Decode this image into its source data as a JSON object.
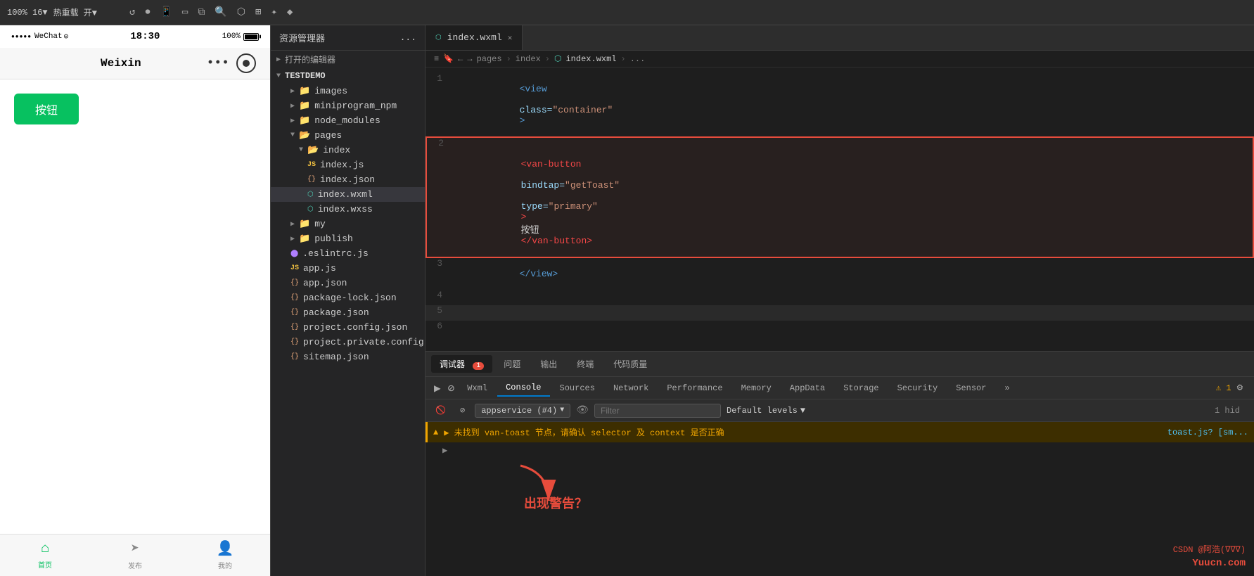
{
  "toolbar": {
    "zoom_label": "100% 16▼",
    "hot_reload_label": "热重载 开▼",
    "icons": [
      "↺",
      "⏺",
      "📱",
      "⬜",
      "📋",
      "🔍",
      "⬡",
      "⬢",
      "✦",
      "♦"
    ]
  },
  "explorer": {
    "title": "资源管理器",
    "more": "...",
    "open_editors_label": "打开的编辑器",
    "project_name": "TESTDEMO",
    "folders": [
      {
        "name": "images",
        "indent": 2,
        "type": "folder"
      },
      {
        "name": "miniprogram_npm",
        "indent": 2,
        "type": "folder"
      },
      {
        "name": "node_modules",
        "indent": 2,
        "type": "folder"
      },
      {
        "name": "pages",
        "indent": 2,
        "type": "folder"
      },
      {
        "name": "index",
        "indent": 3,
        "type": "folder"
      },
      {
        "name": "index.js",
        "indent": 4,
        "type": "js"
      },
      {
        "name": "index.json",
        "indent": 4,
        "type": "json"
      },
      {
        "name": "index.wxml",
        "indent": 4,
        "type": "wxml",
        "active": true
      },
      {
        "name": "index.wxss",
        "indent": 4,
        "type": "wxss"
      },
      {
        "name": "my",
        "indent": 2,
        "type": "folder"
      },
      {
        "name": "publish",
        "indent": 2,
        "type": "folder"
      },
      {
        "name": ".eslintrc.js",
        "indent": 2,
        "type": "eslint"
      },
      {
        "name": "app.js",
        "indent": 2,
        "type": "js"
      },
      {
        "name": "app.json",
        "indent": 2,
        "type": "json"
      },
      {
        "name": "package-lock.json",
        "indent": 2,
        "type": "json"
      },
      {
        "name": "package.json",
        "indent": 2,
        "type": "json"
      },
      {
        "name": "project.config.json",
        "indent": 2,
        "type": "json"
      },
      {
        "name": "project.private.config.js...",
        "indent": 2,
        "type": "json"
      },
      {
        "name": "sitemap.json",
        "indent": 2,
        "type": "json"
      }
    ]
  },
  "editor": {
    "tab_name": "index.wxml",
    "breadcrumb": [
      "pages",
      "index",
      "index.wxml",
      "..."
    ],
    "lines": [
      {
        "num": 1,
        "content": "<view class=\"container\">",
        "highlight": false
      },
      {
        "num": 2,
        "content": "  <van-button bindtap=\"getToast\" type=\"primary\">按钮</van-button>",
        "highlight": true
      },
      {
        "num": 3,
        "content": "</view>",
        "highlight": false
      },
      {
        "num": 4,
        "content": "",
        "highlight": false
      },
      {
        "num": 5,
        "content": "",
        "highlight": false,
        "gray": true
      },
      {
        "num": 6,
        "content": "",
        "highlight": false
      }
    ]
  },
  "devtools": {
    "top_tabs": [
      {
        "label": "调试器",
        "badge": "1",
        "active": true
      },
      {
        "label": "问题",
        "active": false
      },
      {
        "label": "输出",
        "active": false
      },
      {
        "label": "终端",
        "active": false
      },
      {
        "label": "代码质量",
        "active": false
      }
    ],
    "inner_tabs": [
      {
        "label": "Wxml",
        "active": false
      },
      {
        "label": "Console",
        "active": true
      },
      {
        "label": "Sources",
        "active": false
      },
      {
        "label": "Network",
        "active": false
      },
      {
        "label": "Performance",
        "active": false
      },
      {
        "label": "Memory",
        "active": false
      },
      {
        "label": "AppData",
        "active": false
      },
      {
        "label": "Storage",
        "active": false
      },
      {
        "label": "Security",
        "active": false
      },
      {
        "label": "Sensor",
        "active": false
      }
    ],
    "toolbar": {
      "filter_placeholder": "Filter",
      "levels_label": "Default levels",
      "appservice_label": "appservice (#4)",
      "hid_label": "1 hid"
    },
    "warning": {
      "text": "▶ 未找到 van-toast 节点，请确认 selector 及 context 是否正确",
      "source": "toast.js? [sm..."
    },
    "annotation": {
      "arrow": "↙",
      "text": "出现警告？"
    }
  },
  "phone": {
    "status": {
      "dots": "●●●●●",
      "carrier": "WeChat",
      "wifi": "⊙",
      "time": "18:30",
      "battery": "100%"
    },
    "nav_title": "Weixin",
    "button_label": "按钮",
    "bottom_nav": [
      {
        "label": "首页",
        "active": true,
        "icon": "⌂"
      },
      {
        "label": "发布",
        "active": false,
        "icon": "✈"
      },
      {
        "label": "我的",
        "active": false,
        "icon": "○"
      }
    ]
  },
  "watermark": {
    "yuucn": "Yuucn.com",
    "csdn": "CSDN @阿浩(∇∇∇)"
  }
}
